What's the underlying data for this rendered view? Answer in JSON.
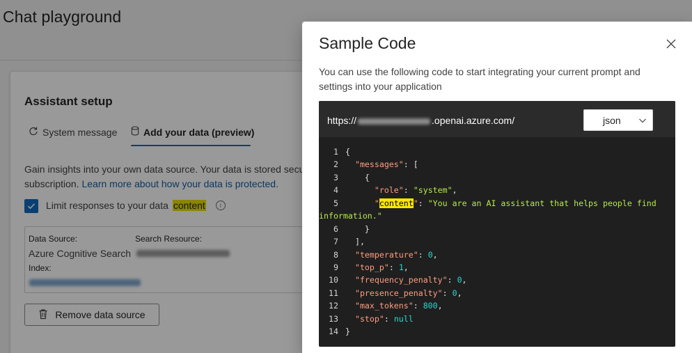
{
  "page": {
    "title": "Chat playground"
  },
  "assistant_setup": {
    "title": "Assistant setup",
    "tabs": [
      {
        "label": "System message",
        "icon": "refresh-icon"
      },
      {
        "label": "Add your data (preview)",
        "icon": "database-icon",
        "selected": true
      }
    ],
    "info_text_1": "Gain insights into your own data source. Your data is stored secu",
    "info_text_2": "subscription.",
    "info_link": "Learn more about how your data is protected.",
    "limit_label": "Limit responses to your data",
    "limit_highlight": "content",
    "limit_checked": true,
    "data_source_label": "Data Source:",
    "data_source_value": "Azure Cognitive Search",
    "search_resource_label": "Search Resource:",
    "index_label": "Index:",
    "remove_button": "Remove data source"
  },
  "modal": {
    "title": "Sample Code",
    "description": "You can use the following code to start integrating your current prompt and settings into your application",
    "endpoint_prefix": "https://",
    "endpoint_suffix": ".openai.azure.com/",
    "language": "json",
    "code_lines": [
      {
        "n": "1",
        "text": "{"
      },
      {
        "n": "2",
        "indent": "  ",
        "key": "\"messages\"",
        "rest": ": ["
      },
      {
        "n": "3",
        "text": "    {"
      },
      {
        "n": "4",
        "indent": "      ",
        "key": "\"role\"",
        "mid": ": ",
        "str": "\"system\"",
        "rest": ","
      },
      {
        "n": "5",
        "indent": "      ",
        "key_pre": "\"",
        "key_hl": "content",
        "key_post": "\"",
        "mid": ": ",
        "str": "\"You are an AI assistant that helps people find"
      },
      {
        "n": "",
        "wrap": "information.\""
      },
      {
        "n": "6",
        "text": "    }"
      },
      {
        "n": "7",
        "text": "  ],"
      },
      {
        "n": "8",
        "indent": "  ",
        "key": "\"temperature\"",
        "mid": ": ",
        "num": "0",
        "rest": ","
      },
      {
        "n": "9",
        "indent": "  ",
        "key": "\"top_p\"",
        "mid": ": ",
        "num": "1",
        "rest": ","
      },
      {
        "n": "10",
        "indent": "  ",
        "key": "\"frequency_penalty\"",
        "mid": ": ",
        "num": "0",
        "rest": ","
      },
      {
        "n": "11",
        "indent": "  ",
        "key": "\"presence_penalty\"",
        "mid": ": ",
        "num": "0",
        "rest": ","
      },
      {
        "n": "12",
        "indent": "  ",
        "key": "\"max_tokens\"",
        "mid": ": ",
        "num": "800",
        "rest": ","
      },
      {
        "n": "13",
        "indent": "  ",
        "key": "\"stop\"",
        "mid": ": ",
        "num": "null",
        "rest": ""
      },
      {
        "n": "14",
        "text": "}"
      }
    ]
  },
  "colors": {
    "accent": "#0f6cbd",
    "code_bg": "#1f1f1f",
    "code_key": "#ff9e80",
    "code_string": "#b5e84a",
    "code_number": "#27d9cf",
    "highlight": "#ffe600"
  }
}
